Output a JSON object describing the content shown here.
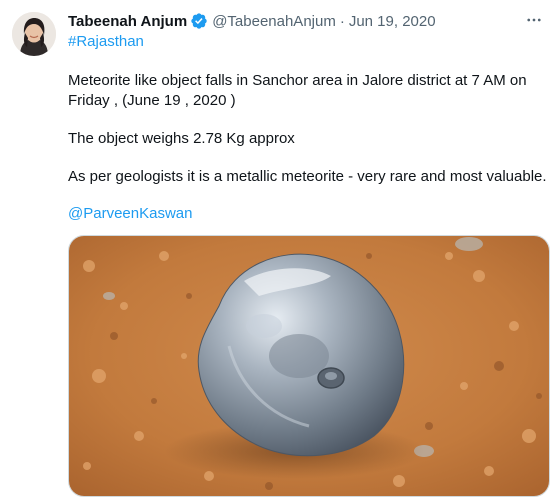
{
  "tweet": {
    "author_name": "Tabeenah Anjum",
    "handle": "@TabeenahAnjum",
    "separator": "·",
    "date": "Jun 19, 2020",
    "hashtag": "#Rajasthan",
    "line1": "Meteorite like object falls in Sanchor area in Jalore district at 7 AM on",
    "line2": "Friday , (June 19 , 2020 )",
    "line3": "The object weighs  2.78 Kg approx",
    "line4": "As per geologists it is a metallic meteorite - very rare and most valuable.",
    "mention": "@ParveenKaswan"
  },
  "icons": {
    "verified": "verified-badge-icon",
    "more": "more-options-icon"
  },
  "colors": {
    "link": "#1d9bf0",
    "text": "#0f1419",
    "muted": "#536471",
    "soil": "#c47a3f",
    "meteorite": "#8e9aa8"
  }
}
